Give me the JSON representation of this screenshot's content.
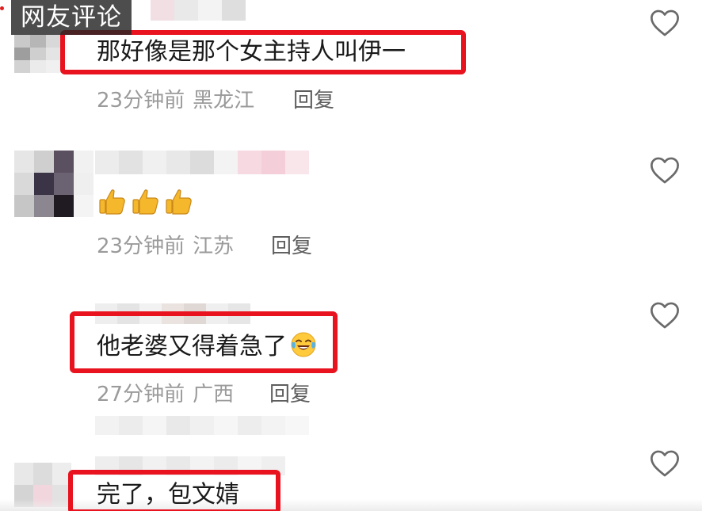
{
  "watermark": "网友评论",
  "comments": [
    {
      "text": "那好像是那个女主持人叫伊一",
      "time": "23分钟前",
      "region": "黑龙江",
      "reply": "回复"
    },
    {
      "text": "👍👍👍",
      "time": "23分钟前",
      "region": "江苏",
      "reply": "回复"
    },
    {
      "text": "他老婆又得着急了",
      "emoji": "crying-laughing-face",
      "time": "27分钟前",
      "region": "广西",
      "reply": "回复"
    },
    {
      "text": "完了，包文婧"
    }
  ],
  "icons": {
    "like": "heart-outline-icon",
    "thumbs": "thumbs-up-emoji"
  },
  "colors": {
    "highlight": "#e8131f",
    "meta_text": "#9a9a9a",
    "reply_text": "#5e5e5e",
    "body_text": "#1a1a1a"
  }
}
